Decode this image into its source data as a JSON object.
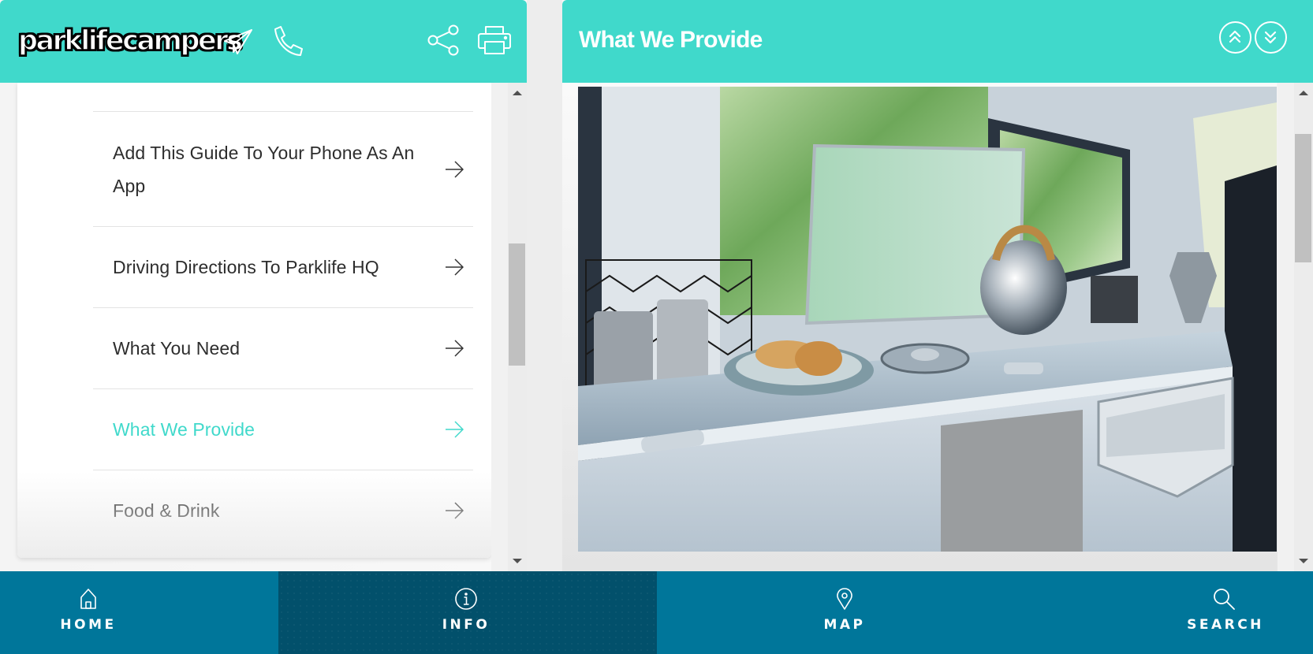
{
  "brand": {
    "logo_text": "parklifecampers",
    "primary_color": "#40d9cb",
    "nav_color": "#00769a",
    "nav_active_color": "#02506b"
  },
  "left_header": {
    "icons": [
      "send-icon",
      "phone-icon",
      "share-icon",
      "print-icon"
    ]
  },
  "menu": {
    "items": [
      {
        "label": "Add This Guide To Your Phone As An App",
        "active": false
      },
      {
        "label": "Driving Directions To Parklife HQ",
        "active": false
      },
      {
        "label": "What You Need",
        "active": false
      },
      {
        "label": "What We Provide",
        "active": true
      },
      {
        "label": "Food & Drink",
        "active": false
      }
    ]
  },
  "content": {
    "title": "What We Provide",
    "nav_buttons": [
      "previous-section",
      "next-section"
    ],
    "image_alt": "Campervan kitchen with stove, kettle, croissants and drawer"
  },
  "bottom_nav": {
    "items": [
      {
        "label": "HOME",
        "icon": "home-icon",
        "active": false
      },
      {
        "label": "INFO",
        "icon": "info-icon",
        "active": true
      },
      {
        "label": "MAP",
        "icon": "map-pin-icon",
        "active": false
      },
      {
        "label": "SEARCH",
        "icon": "search-icon",
        "active": false
      }
    ]
  }
}
